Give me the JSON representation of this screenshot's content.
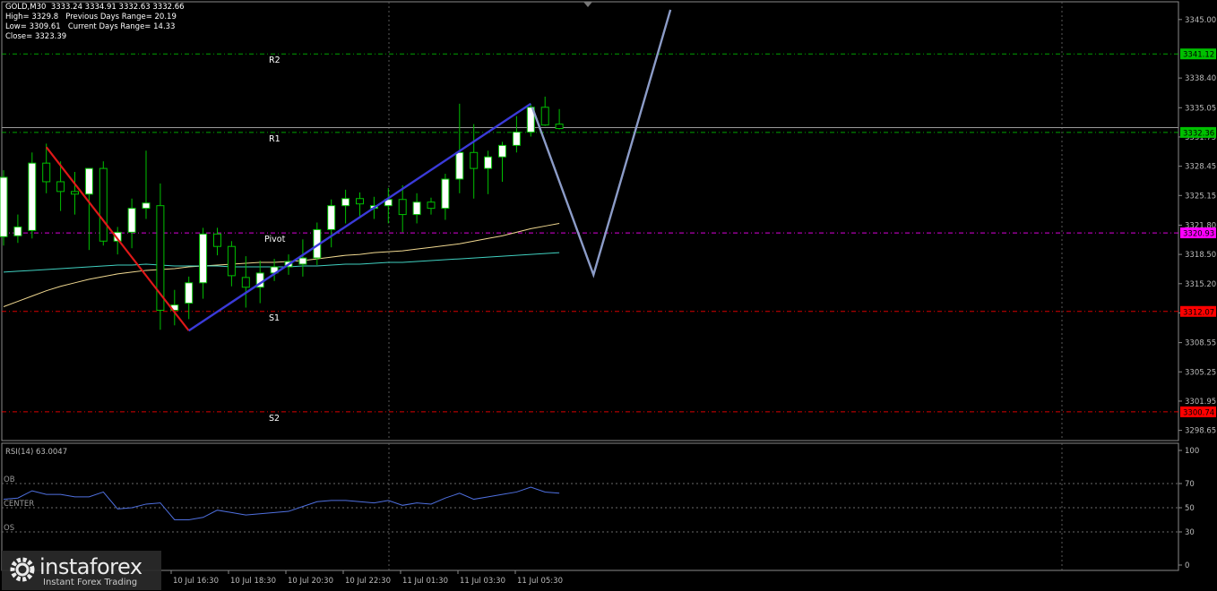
{
  "header": {
    "symbol": "GOLD,M30",
    "ohlc": "3333.24 3334.91 3332.63 3332.66",
    "high_line": "High= 3329.8",
    "prev_range": "Previous Days Range= 20.19",
    "low_line": "Low= 3309.61",
    "curr_range": "Current Days Range= 14.33",
    "close_line": "Close= 3323.39"
  },
  "chart_data": {
    "type": "candlestick",
    "price_axis_ticks": [
      "3345.00",
      "3338.40",
      "3335.05",
      "3331.75",
      "3328.45",
      "3325.15",
      "3321.80",
      "3318.50",
      "3315.20",
      "3311.90",
      "3308.55",
      "3305.25",
      "3301.95",
      "3298.65"
    ],
    "ylim": [
      3297.5,
      3347.0
    ],
    "x_labels": [
      "10 Jul 16:30",
      "10 Jul 18:30",
      "10 Jul 20:30",
      "10 Jul 22:30",
      "11 Jul 01:30",
      "11 Jul 03:30",
      "11 Jul 05:30"
    ],
    "levels": [
      {
        "name": "R2",
        "value": 3341.12,
        "label": "3341.12",
        "color": "#00c000"
      },
      {
        "name": "R1",
        "value": 3332.26,
        "label": "3332.36",
        "color": "#00c000"
      },
      {
        "name": "Pivot",
        "value": 3320.93,
        "label": "3320.93",
        "color": "#ff00ff"
      },
      {
        "name": "S1",
        "value": 3312.07,
        "label": "3312.07",
        "color": "#ff0000"
      },
      {
        "name": "S2",
        "value": 3300.74,
        "label": "3300.74",
        "color": "#ff0000"
      }
    ],
    "candles": [
      {
        "o": 3320.5,
        "h": 3328.0,
        "l": 3319.5,
        "c": 3327.2
      },
      {
        "o": 3320.6,
        "h": 3323.0,
        "l": 3319.8,
        "c": 3321.6
      },
      {
        "o": 3321.2,
        "h": 3330.0,
        "l": 3320.3,
        "c": 3328.8
      },
      {
        "o": 3328.8,
        "h": 3331.0,
        "l": 3325.4,
        "c": 3326.7
      },
      {
        "o": 3326.7,
        "h": 3329.0,
        "l": 3323.4,
        "c": 3325.6
      },
      {
        "o": 3325.6,
        "h": 3327.8,
        "l": 3323.0,
        "c": 3325.3
      },
      {
        "o": 3325.3,
        "h": 3327.0,
        "l": 3319.0,
        "c": 3328.2
      },
      {
        "o": 3328.2,
        "h": 3329.0,
        "l": 3319.5,
        "c": 3320.0
      },
      {
        "o": 3320.0,
        "h": 3321.6,
        "l": 3318.5,
        "c": 3321.0
      },
      {
        "o": 3321.0,
        "h": 3324.8,
        "l": 3319.2,
        "c": 3323.7
      },
      {
        "o": 3323.7,
        "h": 3330.2,
        "l": 3322.5,
        "c": 3324.3
      },
      {
        "o": 3324.0,
        "h": 3326.5,
        "l": 3310.0,
        "c": 3312.2
      },
      {
        "o": 3312.2,
        "h": 3314.5,
        "l": 3310.5,
        "c": 3312.8
      },
      {
        "o": 3313.0,
        "h": 3316.0,
        "l": 3311.2,
        "c": 3315.3
      },
      {
        "o": 3315.3,
        "h": 3321.5,
        "l": 3313.5,
        "c": 3320.8
      },
      {
        "o": 3320.8,
        "h": 3321.5,
        "l": 3318.4,
        "c": 3319.4
      },
      {
        "o": 3319.4,
        "h": 3320.0,
        "l": 3314.9,
        "c": 3316.1
      },
      {
        "o": 3315.9,
        "h": 3318.3,
        "l": 3312.5,
        "c": 3314.8
      },
      {
        "o": 3314.8,
        "h": 3317.8,
        "l": 3313.0,
        "c": 3316.4
      },
      {
        "o": 3316.4,
        "h": 3318.0,
        "l": 3315.5,
        "c": 3317.1
      },
      {
        "o": 3317.1,
        "h": 3318.5,
        "l": 3316.2,
        "c": 3317.7
      },
      {
        "o": 3317.4,
        "h": 3320.2,
        "l": 3316.0,
        "c": 3318.1
      },
      {
        "o": 3318.1,
        "h": 3322.1,
        "l": 3317.3,
        "c": 3321.3
      },
      {
        "o": 3321.3,
        "h": 3324.7,
        "l": 3319.3,
        "c": 3324.0
      },
      {
        "o": 3324.0,
        "h": 3325.8,
        "l": 3322.0,
        "c": 3324.8
      },
      {
        "o": 3324.8,
        "h": 3325.5,
        "l": 3322.7,
        "c": 3324.2
      },
      {
        "o": 3323.7,
        "h": 3325.0,
        "l": 3322.5,
        "c": 3324.0
      },
      {
        "o": 3324.0,
        "h": 3326.0,
        "l": 3322.0,
        "c": 3324.7
      },
      {
        "o": 3324.7,
        "h": 3326.3,
        "l": 3321.0,
        "c": 3323.0
      },
      {
        "o": 3323.0,
        "h": 3325.4,
        "l": 3322.0,
        "c": 3324.4
      },
      {
        "o": 3324.4,
        "h": 3324.9,
        "l": 3323.0,
        "c": 3323.7
      },
      {
        "o": 3323.7,
        "h": 3327.6,
        "l": 3322.4,
        "c": 3327.0
      },
      {
        "o": 3327.0,
        "h": 3335.5,
        "l": 3325.4,
        "c": 3330.0
      },
      {
        "o": 3330.0,
        "h": 3333.2,
        "l": 3324.8,
        "c": 3328.2
      },
      {
        "o": 3328.2,
        "h": 3330.2,
        "l": 3325.3,
        "c": 3329.5
      },
      {
        "o": 3329.5,
        "h": 3331.2,
        "l": 3326.7,
        "c": 3330.8
      },
      {
        "o": 3330.8,
        "h": 3334.1,
        "l": 3330.0,
        "c": 3332.3
      },
      {
        "o": 3332.3,
        "h": 3335.5,
        "l": 3331.8,
        "c": 3335.1
      },
      {
        "o": 3335.1,
        "h": 3336.3,
        "l": 3333.0,
        "c": 3333.1
      },
      {
        "o": 3333.2,
        "h": 3334.9,
        "l": 3332.6,
        "c": 3332.7
      }
    ],
    "ma_fast": [
      3312.6,
      3313.2,
      3313.8,
      3314.4,
      3314.9,
      3315.3,
      3315.7,
      3316.0,
      3316.3,
      3316.5,
      3316.7,
      3316.8,
      3316.9,
      3317.1,
      3317.2,
      3317.3,
      3317.4,
      3317.5,
      3317.6,
      3317.6,
      3317.7,
      3317.8,
      3318.0,
      3318.2,
      3318.4,
      3318.5,
      3318.7,
      3318.8,
      3318.9,
      3319.1,
      3319.3,
      3319.5,
      3319.7,
      3320.0,
      3320.3,
      3320.6,
      3321.0,
      3321.4,
      3321.7,
      3322.0
    ],
    "ma_slow": [
      3316.5,
      3316.6,
      3316.7,
      3316.8,
      3316.9,
      3317.0,
      3317.1,
      3317.2,
      3317.3,
      3317.3,
      3317.4,
      3317.3,
      3317.2,
      3317.2,
      3317.2,
      3317.2,
      3317.1,
      3317.1,
      3317.1,
      3317.1,
      3317.1,
      3317.2,
      3317.2,
      3317.3,
      3317.4,
      3317.4,
      3317.5,
      3317.6,
      3317.6,
      3317.7,
      3317.8,
      3317.9,
      3318.0,
      3318.1,
      3318.2,
      3318.3,
      3318.4,
      3318.5,
      3318.6,
      3318.7
    ],
    "trend_down": [
      {
        "i": 3,
        "p": 3330.6
      },
      {
        "i": 13,
        "p": 3309.9
      }
    ],
    "trend_up": [
      {
        "i": 13,
        "p": 3309.9
      },
      {
        "i": 37,
        "p": 3335.5
      }
    ],
    "forecast": [
      {
        "i": 37.1,
        "p": 3335.1
      },
      {
        "i": 41.4,
        "p": 3316.2
      },
      {
        "i": 46.8,
        "p": 3346.1
      }
    ],
    "rsi": {
      "label": "RSI(14) 63.0047",
      "ticks": [
        "100",
        "70",
        "50",
        "30",
        "0"
      ],
      "levels": [
        {
          "name": "OB",
          "value": 70
        },
        {
          "name": "CENTER",
          "value": 50
        },
        {
          "name": "OS",
          "value": 30
        }
      ],
      "values": [
        57,
        58,
        64,
        61,
        61,
        59,
        59,
        63,
        49,
        50,
        53,
        54,
        40,
        40,
        42,
        48,
        46,
        44,
        45,
        46,
        47,
        51,
        55,
        56,
        56,
        55,
        54,
        56,
        52,
        54,
        53,
        58,
        62,
        57,
        59,
        61,
        63,
        67,
        63,
        62
      ]
    }
  },
  "logo": {
    "brand": "instaforex",
    "tagline": "Instant Forex Trading"
  }
}
